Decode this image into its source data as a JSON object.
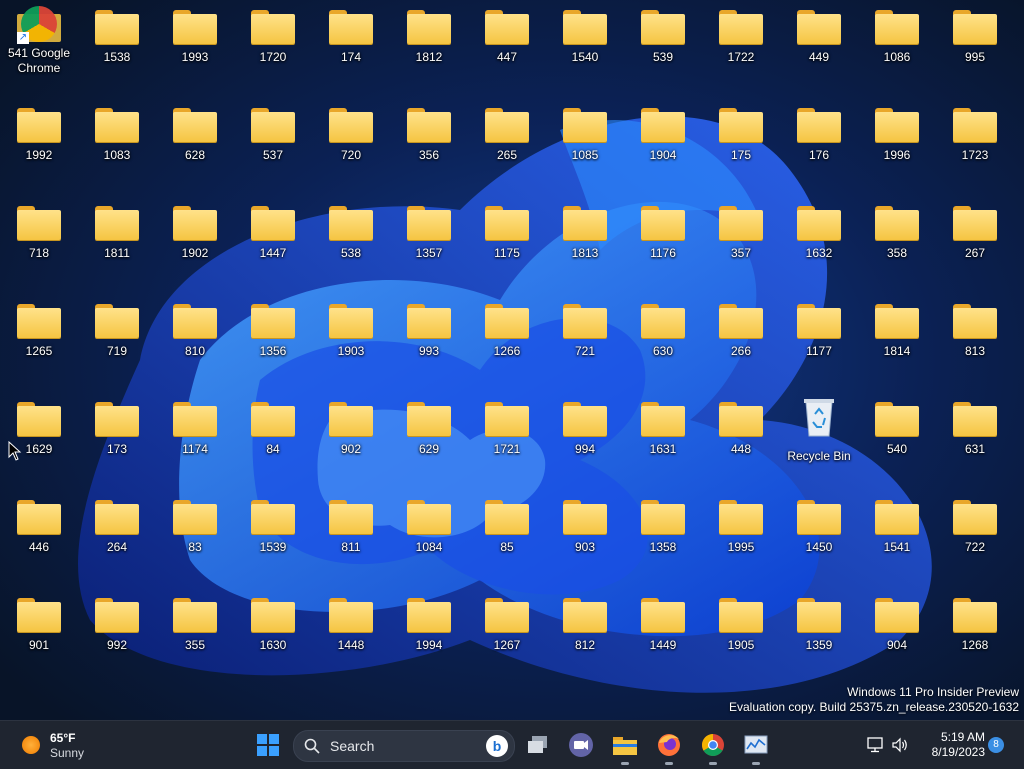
{
  "desktop": {
    "chrome_shortcut_label": "Google Chrome",
    "recycle_bin_label": "Recycle Bin",
    "folders": [
      [
        "",
        "1538",
        "1993",
        "1720",
        "174",
        "1812",
        "447",
        "1540",
        "539",
        "1722",
        "449",
        "1086",
        "995"
      ],
      [
        "1992",
        "1083",
        "628",
        "537",
        "720",
        "356",
        "265",
        "1085",
        "1904",
        "175",
        "176",
        "1996",
        "1723"
      ],
      [
        "718",
        "1811",
        "1902",
        "1447",
        "538",
        "1357",
        "1175",
        "1813",
        "1176",
        "357",
        "1632",
        "358",
        "267"
      ],
      [
        "1265",
        "719",
        "810",
        "1356",
        "1903",
        "993",
        "1266",
        "721",
        "630",
        "266",
        "1177",
        "1814",
        "813"
      ],
      [
        "1629",
        "173",
        "1174",
        "84",
        "902",
        "629",
        "1721",
        "994",
        "1631",
        "448",
        "",
        "540",
        "631"
      ],
      [
        "446",
        "264",
        "83",
        "1539",
        "811",
        "1084",
        "85",
        "903",
        "1358",
        "1995",
        "1450",
        "1541",
        "722"
      ],
      [
        "901",
        "992",
        "355",
        "1630",
        "1448",
        "1994",
        "1267",
        "812",
        "1449",
        "1905",
        "1359",
        "904",
        "1268"
      ]
    ],
    "overlapping_folder_label": "541"
  },
  "watermark": {
    "line1": "Windows 11 Pro Insider Preview",
    "line2": "Evaluation copy. Build 25375.zn_release.230520-1632"
  },
  "taskbar": {
    "weather": {
      "temp": "65°F",
      "condition": "Sunny"
    },
    "search_placeholder": "Search",
    "clock": {
      "time": "5:19 AM",
      "date": "8/19/2023"
    },
    "notification_count": "8",
    "apps": [
      {
        "name": "task-view-icon"
      },
      {
        "name": "meet-icon"
      },
      {
        "name": "file-explorer-icon"
      },
      {
        "name": "firefox-icon"
      },
      {
        "name": "chrome-icon"
      },
      {
        "name": "performance-monitor-icon"
      }
    ]
  },
  "colors": {
    "folder": "#f5c542",
    "taskbar": "#1f2530",
    "accent": "#3b8fe4"
  }
}
